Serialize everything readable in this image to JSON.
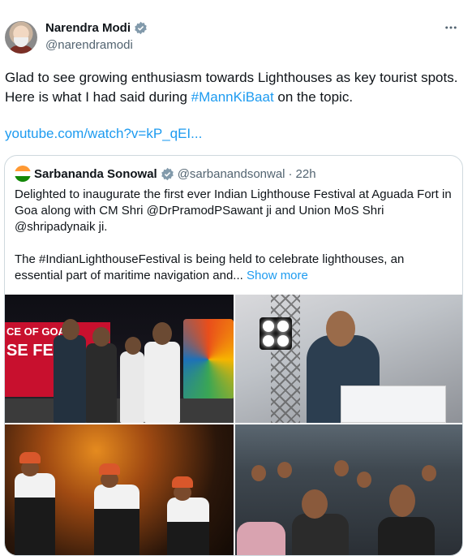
{
  "tweet": {
    "author_name": "Narendra Modi",
    "author_handle": "@narendramodi",
    "more_icon": "more-horizontal-icon",
    "verified_icon": "verified-badge-icon",
    "text_before": "Glad to see growing enthusiasm towards Lighthouses as key tourist spots. Here is what I had said during ",
    "hashtag": "#MannKiBaat",
    "text_after": " on the topic.",
    "link": "youtube.com/watch?v=kP_qEI..."
  },
  "quote": {
    "author_name": "Sarbananda Sonowal",
    "author_handle": "@sarbanandsonwal",
    "separator": "·",
    "time": "22h",
    "paragraph1": "Delighted to inaugurate the first ever Indian Lighthouse Festival at Aguada Fort in Goa along with CM Shri @DrPramodPSawant ji and Union MoS Shri @shripadynaik ji.",
    "paragraph2": "The #IndianLighthouseFestival is being held to celebrate lighthouses, an essential part of maritime navigation and...",
    "show_more": "Show more",
    "photos": [
      {
        "banner_line1": "CE OF GOA",
        "banner_line2": "SE FES"
      },
      {},
      {},
      {}
    ]
  },
  "colors": {
    "link": "#1d9bf0",
    "text": "#0f1419",
    "secondary": "#536471",
    "border": "#cfd9de"
  }
}
